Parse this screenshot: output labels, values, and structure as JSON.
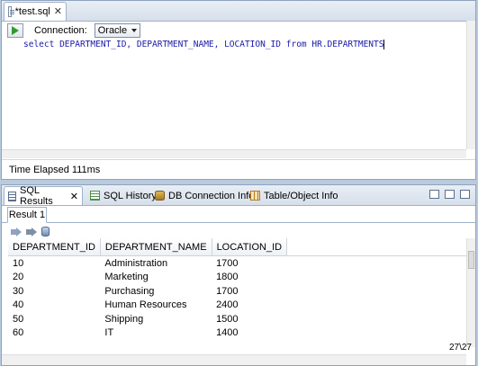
{
  "editor": {
    "tab_label": "*test.sql",
    "tab_close": "✕",
    "connection_label": "Connection:",
    "connection_value": "Oracle",
    "sql_parts": {
      "select_kw": "select",
      "columns": "DEPARTMENT_ID, DEPARTMENT_NAME, LOCATION_ID",
      "from_kw": "from",
      "table": "HR.DEPARTMENTS"
    },
    "time_elapsed": "Time Elapsed 111ms"
  },
  "results": {
    "tabs": [
      {
        "label": "SQL Results",
        "icon": "grid-icon",
        "close": "✕"
      },
      {
        "label": "SQL History",
        "icon": "history-icon"
      },
      {
        "label": "DB Connection Info",
        "icon": "db-connection-icon"
      },
      {
        "label": "Table/Object Info",
        "icon": "table-icon"
      }
    ],
    "subtab": "Result 1",
    "columns": [
      "DEPARTMENT_ID",
      "DEPARTMENT_NAME",
      "LOCATION_ID"
    ],
    "rows": [
      [
        "10",
        "Administration",
        "1700"
      ],
      [
        "20",
        "Marketing",
        "1800"
      ],
      [
        "30",
        "Purchasing",
        "1700"
      ],
      [
        "40",
        "Human Resources",
        "2400"
      ],
      [
        "50",
        "Shipping",
        "1500"
      ],
      [
        "60",
        "IT",
        "1400"
      ]
    ],
    "row_counter": "27\\27"
  }
}
